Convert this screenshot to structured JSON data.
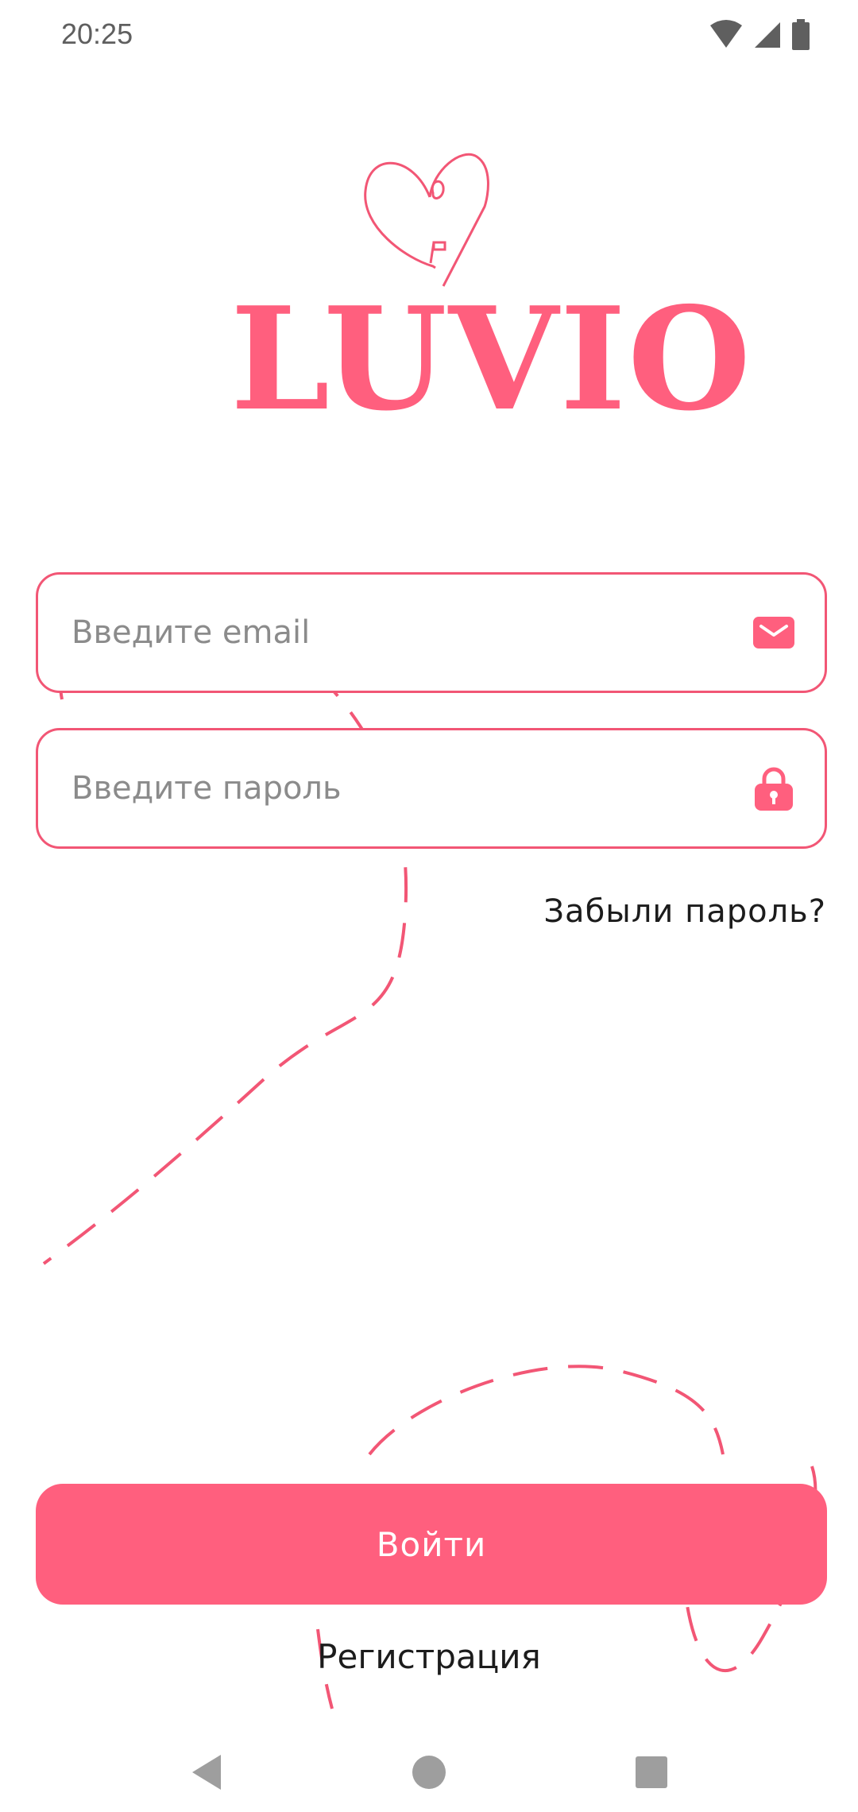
{
  "status_bar": {
    "time": "20:25",
    "icons": [
      "wifi-alert-icon",
      "cell-signal-icon",
      "battery-icon"
    ]
  },
  "logo": {
    "text": "LUVIO",
    "icon": "heart-icon"
  },
  "form": {
    "email": {
      "placeholder": "Введите email",
      "value": "",
      "icon": "mail-icon"
    },
    "password": {
      "placeholder": "Введите пароль",
      "value": "",
      "icon": "lock-icon"
    },
    "forgot_label": "Забыли пароль?"
  },
  "actions": {
    "login_label": "Войти",
    "register_label": "Регистрация"
  },
  "nav": {
    "back": "back-icon",
    "home": "home-icon",
    "recents": "recents-icon"
  },
  "colors": {
    "accent": "#ff5f7e",
    "text": "#1c1c1c",
    "placeholder": "#8b8b8b"
  }
}
